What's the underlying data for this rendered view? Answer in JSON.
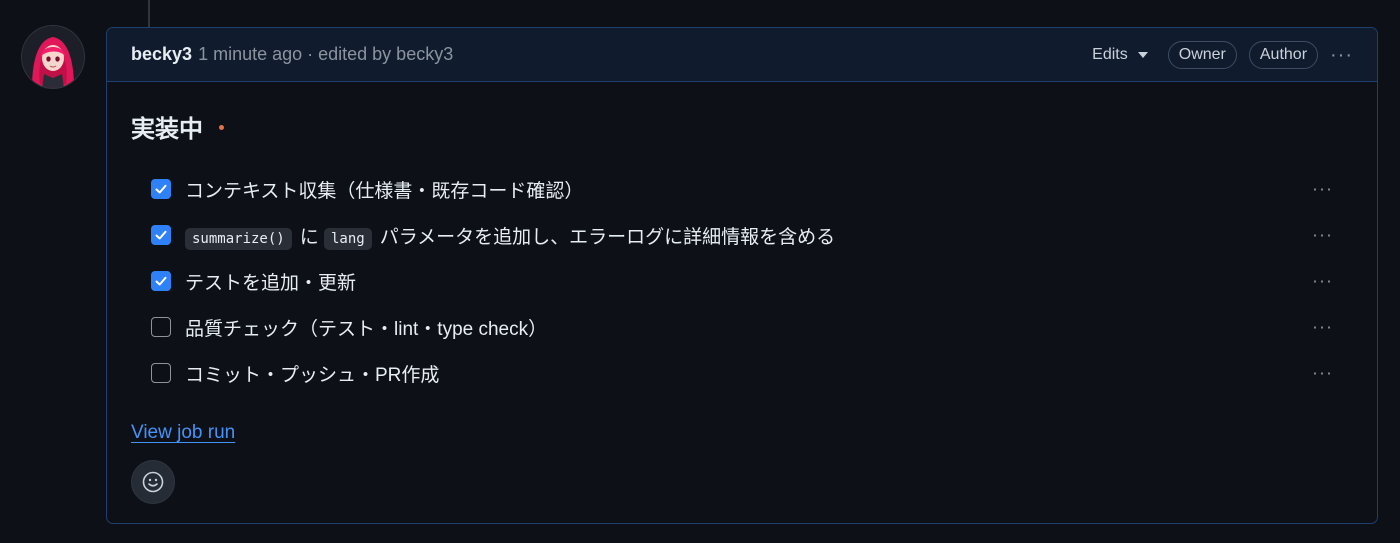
{
  "comment": {
    "author": "becky3",
    "meta": "1 minute ago · edited by becky3",
    "edits_label": "Edits",
    "badges": [
      "Owner",
      "Author"
    ],
    "more_label": "···"
  },
  "body": {
    "heading": "実装中",
    "tasks": [
      {
        "checked": true,
        "segments": [
          {
            "text": "コンテキスト収集（仕様書・既存コード確認）"
          }
        ]
      },
      {
        "checked": true,
        "segments": [
          {
            "code": "summarize()"
          },
          {
            "text": "に "
          },
          {
            "code": "lang"
          },
          {
            "text": "パラメータを追加し、エラーログに詳細情報を含める"
          }
        ]
      },
      {
        "checked": true,
        "segments": [
          {
            "text": "テストを追加・更新"
          }
        ]
      },
      {
        "checked": false,
        "segments": [
          {
            "text": "品質チェック（テスト・lint・type check）"
          }
        ]
      },
      {
        "checked": false,
        "segments": [
          {
            "text": "コミット・プッシュ・PR作成"
          }
        ]
      }
    ],
    "row_more_label": "···",
    "link_text": "View job run"
  },
  "colors": {
    "accent": "#2f81f7",
    "link": "#4493f8",
    "heading_dot": "#e5704a",
    "border": "#1f3f6e"
  },
  "icons": {
    "caret": "chevron-down-icon",
    "reaction": "smiley-icon",
    "check": "check-icon",
    "more": "kebab-horizontal-icon"
  }
}
